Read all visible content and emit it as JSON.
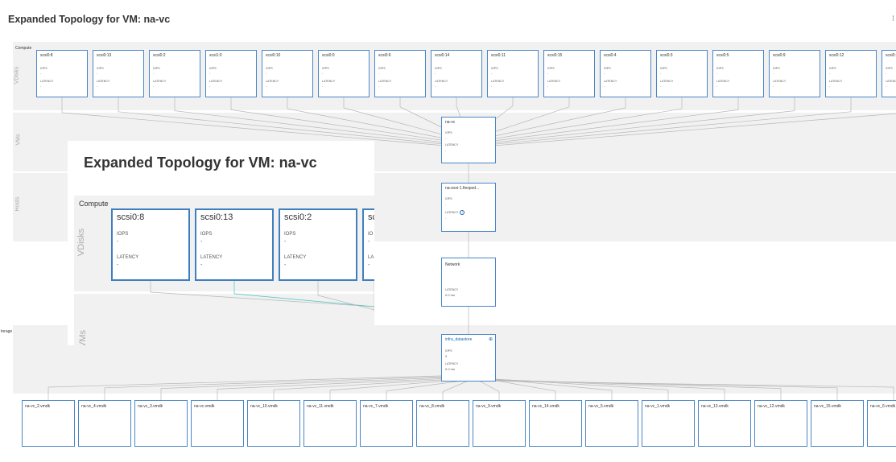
{
  "page": {
    "title": "Expanded Topology for VM: na-vc"
  },
  "labels": {
    "compute": "Compute",
    "storage": "torage",
    "vdisks": "VDisks",
    "vms": "VMs",
    "hosts": "Hosts"
  },
  "vdisks": [
    "scsi0:8",
    "scsi0:13",
    "scsi0:2",
    "scsi1:0",
    "scsi0:10",
    "scsi0:0",
    "scsi0:6",
    "scsi0:14",
    "scsi0:11",
    "scsi0:15",
    "scsi0:4",
    "scsi0:3",
    "scsi0:5",
    "scsi0:9",
    "scsi0:12",
    "scsi0:1"
  ],
  "metrics": {
    "iops": "IOPS",
    "latency": "LATENCY",
    "dash": "-"
  },
  "vm": {
    "name": "na-vc",
    "iops": "IOPS",
    "iops_value": "-",
    "latency": "LATENCY",
    "latency_value": "-"
  },
  "host": {
    "name": "na-esxi-1.fiespod...",
    "iops": "IOPS",
    "iops_value": "-",
    "latency": "LATENCY",
    "latency_value": "-"
  },
  "network": {
    "name": "Network",
    "latency": "LATENCY",
    "latency_value": "0.0 ms"
  },
  "datastore": {
    "name": "infra_datastore",
    "iops": "IOPS",
    "iops_value": "3",
    "latency": "LATENCY",
    "latency_value": "0.0 ms"
  },
  "vmdks": [
    "na-vc_2.vmdk",
    "na-vc_4.vmdk",
    "na-vc_3.vmdk",
    "na-vc.vmdk",
    "na-vc_10.vmdk",
    "na-vc_11.vmdk",
    "na-vc_7.vmdk",
    "na-vc_8.vmdk",
    "na-vc_9.vmdk",
    "na-vc_14.vmdk",
    "na-vc_5.vmdk",
    "na-vc_1.vmdk",
    "na-vc_13.vmdk",
    "na-vc_12.vmdk",
    "na-vc_15.vmdk",
    "na-vc_6.vmdk"
  ],
  "inset": {
    "title": "Expanded Topology for VM: na-vc",
    "compute": "Compute",
    "vdisks_label": "VDisks",
    "vms_label": "VMs",
    "nodes": [
      "scsi0:8",
      "scsi0:13",
      "scsi0:2",
      "sc"
    ],
    "node_iops": [
      "IOPS",
      "IOPS",
      "IOPS",
      "IO"
    ],
    "node_latency": [
      "LATENCY",
      "LATENCY",
      "LATENCY",
      "LA"
    ]
  },
  "colors": {
    "accent": "#4a86c6",
    "band": "#f1f1f1",
    "link": "#1f65b4",
    "teal": "#46c2c2"
  }
}
